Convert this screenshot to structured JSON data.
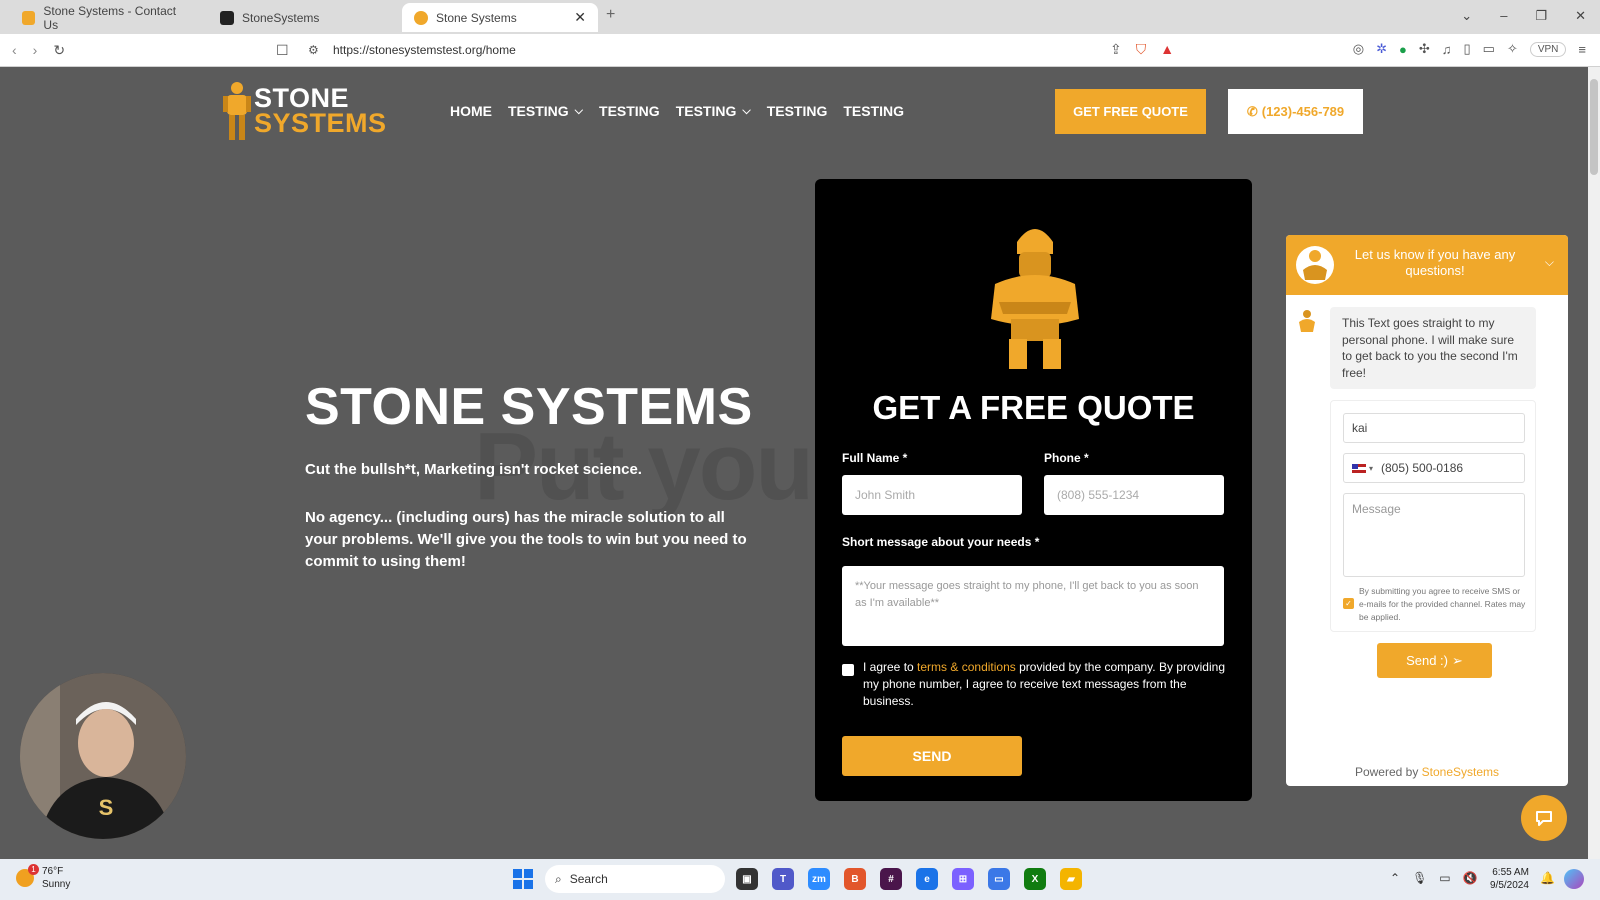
{
  "browser": {
    "tabs": [
      {
        "title": "Stone Systems - Contact Us",
        "active": false
      },
      {
        "title": "StoneSystems",
        "active": false
      },
      {
        "title": "Stone Systems",
        "active": true
      }
    ],
    "url": "https://stonesystemstest.org/home",
    "vpn_label": "VPN"
  },
  "site": {
    "logo": {
      "line1": "STONE",
      "line2": "SYSTEMS"
    },
    "nav": [
      {
        "label": "HOME",
        "dropdown": false
      },
      {
        "label": "TESTING",
        "dropdown": true
      },
      {
        "label": "TESTING",
        "dropdown": false
      },
      {
        "label": "TESTING",
        "dropdown": true
      },
      {
        "label": "TESTING",
        "dropdown": false
      },
      {
        "label": "TESTING",
        "dropdown": false
      }
    ],
    "cta_quote": "GET FREE QUOTE",
    "cta_phone": "(123)-456-789",
    "background_word": "Put your"
  },
  "hero": {
    "title": "STONE SYSTEMS",
    "paragraph1": "Cut the bullsh*t, Marketing isn't rocket science.",
    "paragraph2": "No agency... (including ours) has the miracle solution to all your problems. We'll give you the tools to win but you need to commit to using them!"
  },
  "quote_form": {
    "title": "GET A FREE QUOTE",
    "full_name_label": "Full Name *",
    "full_name_placeholder": "John Smith",
    "phone_label": "Phone *",
    "phone_placeholder": "(808) 555-1234",
    "message_label": "Short message about your needs *",
    "message_placeholder": "**Your message goes straight to my phone, I'll get back to you as soon as I'm available**",
    "agree_prefix": "I agree to ",
    "agree_link": "terms & conditions",
    "agree_suffix": " provided by the company. By providing my phone number, I agree to receive text messages from the business.",
    "agree_checked": false,
    "send_label": "SEND"
  },
  "chat_widget": {
    "header": "Let us know if you have any questions!",
    "bubble": "This Text goes straight to my personal phone. I will make sure to get back to you the second I'm free!",
    "name_value": "kai",
    "phone_value": "(805) 500-0186",
    "message_placeholder": "Message",
    "consent": "By submitting you agree to receive SMS or e-mails for the provided channel. Rates may be applied.",
    "consent_checked": true,
    "send_label": "Send :)",
    "powered_prefix": "Powered by ",
    "powered_brand": "StoneSystems"
  },
  "taskbar": {
    "weather_temp": "76°F",
    "weather_desc": "Sunny",
    "weather_badge": "1",
    "search_placeholder": "Search",
    "time": "6:55 AM",
    "date": "9/5/2024"
  },
  "colors": {
    "accent": "#f0a82b",
    "page_bg": "#5b5b5b",
    "card_bg": "#000000"
  }
}
